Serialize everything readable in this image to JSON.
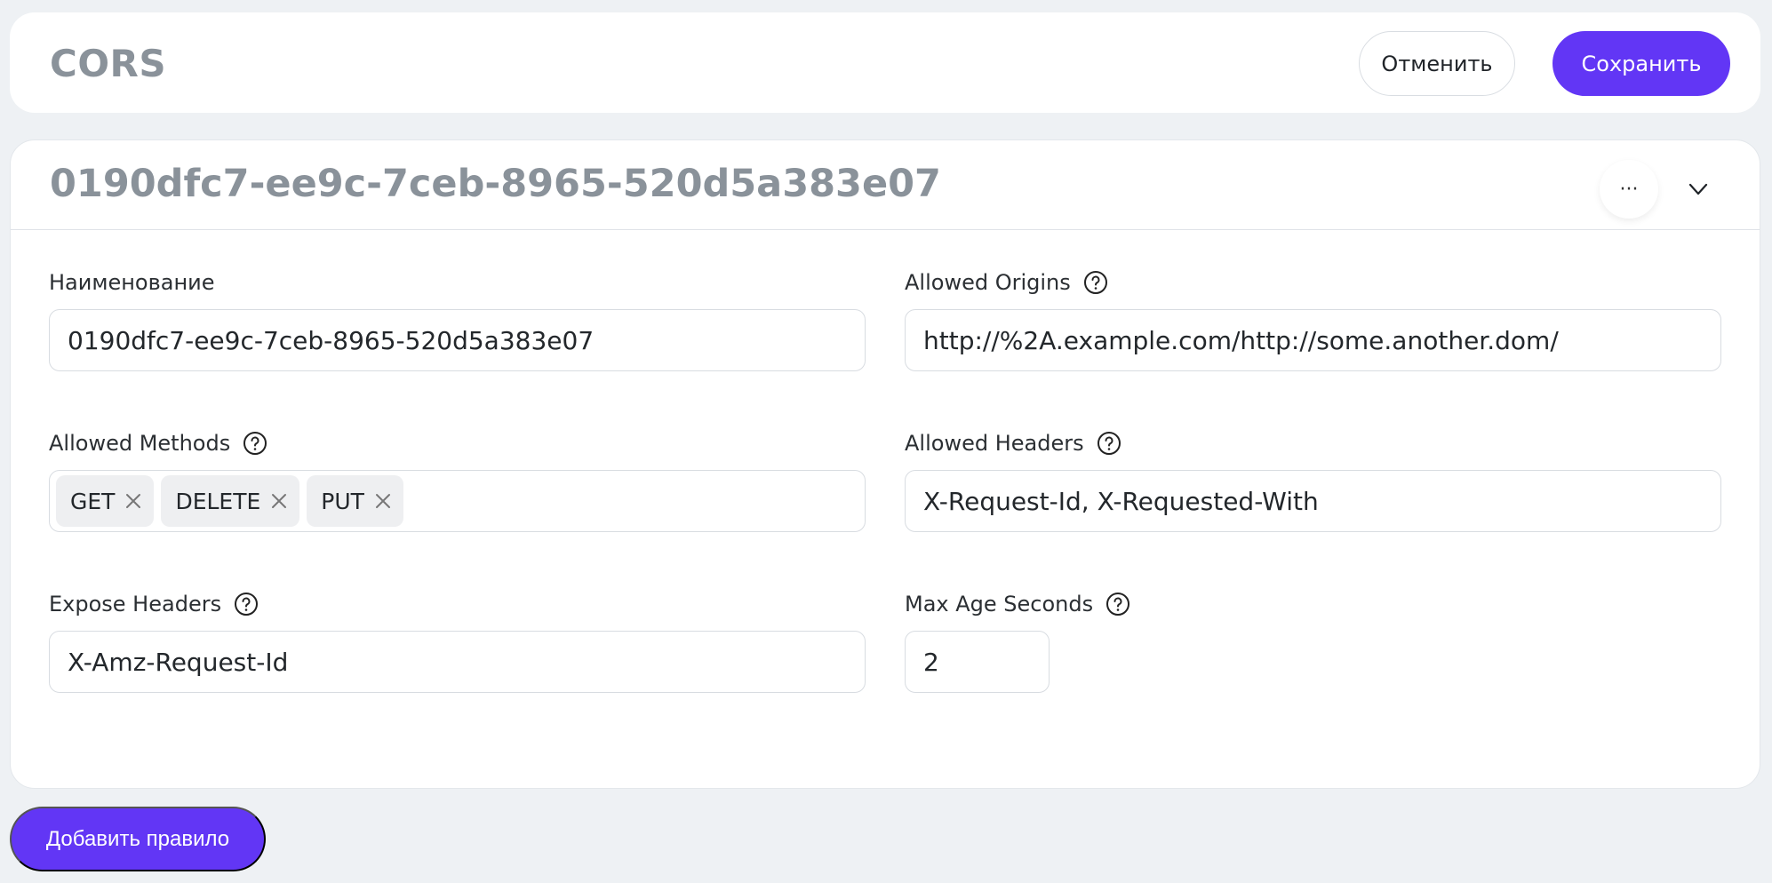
{
  "header": {
    "title": "CORS",
    "cancel_label": "Отменить",
    "save_label": "Сохранить"
  },
  "rule": {
    "title": "0190dfc7-ee9c-7ceb-8965-520d5a383e07",
    "more_label": "···",
    "fields": {
      "name": {
        "label": "Наименование",
        "value": "0190dfc7-ee9c-7ceb-8965-520d5a383e07"
      },
      "allowed_origins": {
        "label": "Allowed Origins",
        "value": "http://%2A.example.com/http://some.another.dom/"
      },
      "allowed_methods": {
        "label": "Allowed Methods",
        "tags": [
          "GET",
          "DELETE",
          "PUT"
        ]
      },
      "allowed_headers": {
        "label": "Allowed Headers",
        "value": "X-Request-Id, X-Requested-With"
      },
      "expose_headers": {
        "label": "Expose Headers",
        "value": "X-Amz-Request-Id"
      },
      "max_age_seconds": {
        "label": "Max Age Seconds",
        "value": "2"
      }
    }
  },
  "footer": {
    "add_rule_label": "Добавить правило"
  },
  "colors": {
    "accent": "#6236f5",
    "background": "#eef1f4",
    "title_gray": "#8a929a"
  },
  "icons": {
    "help": "help-circle-icon",
    "chevron": "chevron-down-icon",
    "tag_remove": "close-icon",
    "more": "more-horizontal-icon"
  }
}
